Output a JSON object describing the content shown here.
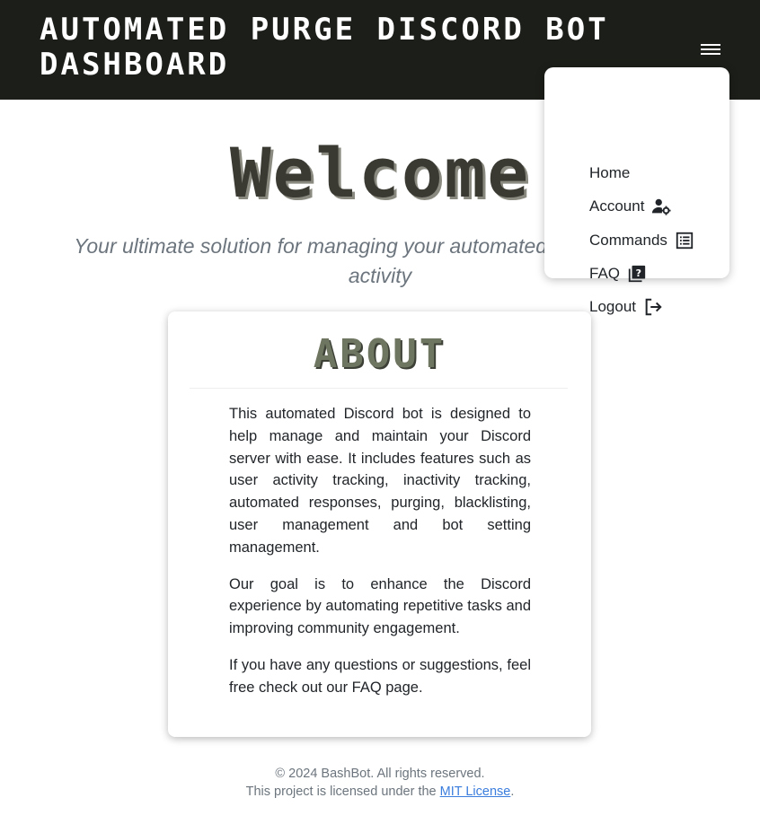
{
  "header": {
    "brand": "AUTOMATED PURGE DISCORD BOT DASHBOARD"
  },
  "menu": {
    "items": [
      {
        "label": "Home",
        "icon": ""
      },
      {
        "label": "Account",
        "icon": "user-gear-icon"
      },
      {
        "label": "Commands",
        "icon": "list-icon"
      },
      {
        "label": "FAQ",
        "icon": "question-book-icon"
      },
      {
        "label": "Logout",
        "icon": "logout-icon"
      }
    ]
  },
  "hero": {
    "title": "Welcome",
    "tagline": "Your ultimate solution for managing your automated Discord server activity"
  },
  "about": {
    "title": "ABOUT",
    "paragraphs": [
      "This automated Discord bot is designed to help manage and maintain your Discord server with ease. It includes features such as user activity tracking, inactivity tracking, automated responses, purging, blacklisting, user management and bot setting management.",
      "Our goal is to enhance the Discord experience by automating repetitive tasks and improving community engagement.",
      "If you have any questions or suggestions, feel free check out our FAQ page."
    ]
  },
  "footer": {
    "copyright": "© 2024 BashBot. All rights reserved.",
    "license_prefix": "This project is licensed under the ",
    "license_link": "MIT License",
    "license_suffix": "."
  },
  "colors": {
    "header_bg": "#1c1e19",
    "link": "#3b7ddd",
    "muted": "#6c757d"
  }
}
